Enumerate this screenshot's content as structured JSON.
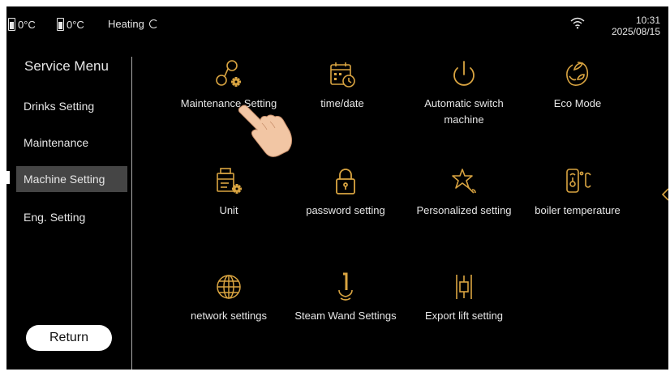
{
  "status_bar": {
    "temp1": "0°C",
    "temp2": "0°C",
    "mode": "Heating",
    "time": "10:31",
    "date": "2025/08/15"
  },
  "sidebar": {
    "title": "Service Menu",
    "items": [
      {
        "label": "Drinks Setting",
        "active": false
      },
      {
        "label": "Maintenance",
        "active": false
      },
      {
        "label": "Machine Setting",
        "active": true
      },
      {
        "label": "Eng. Setting",
        "active": false
      }
    ],
    "return_label": "Return"
  },
  "grid": {
    "items": [
      {
        "label": "Maintenance Setting",
        "icon": "maintenance-gear-icon"
      },
      {
        "label": "time/date",
        "icon": "calendar-clock-icon"
      },
      {
        "label": "Automatic switch machine",
        "icon": "power-icon"
      },
      {
        "label": "Eco Mode",
        "icon": "eco-leaf-icon"
      },
      {
        "label": "Unit",
        "icon": "unit-gear-icon"
      },
      {
        "label": "password setting",
        "icon": "lock-icon"
      },
      {
        "label": "Personalized setting",
        "icon": "star-hand-icon"
      },
      {
        "label": "boiler temperature",
        "icon": "boiler-thermometer-icon"
      },
      {
        "label": "network settings",
        "icon": "globe-icon"
      },
      {
        "label": "Steam Wand Settings",
        "icon": "steam-wand-icon"
      },
      {
        "label": "Export lift setting",
        "icon": "lift-icon"
      }
    ]
  },
  "colors": {
    "background": "#000000",
    "icon_accent": "#d9a441",
    "text": "#e6e6e6",
    "active_item": "#454545"
  }
}
